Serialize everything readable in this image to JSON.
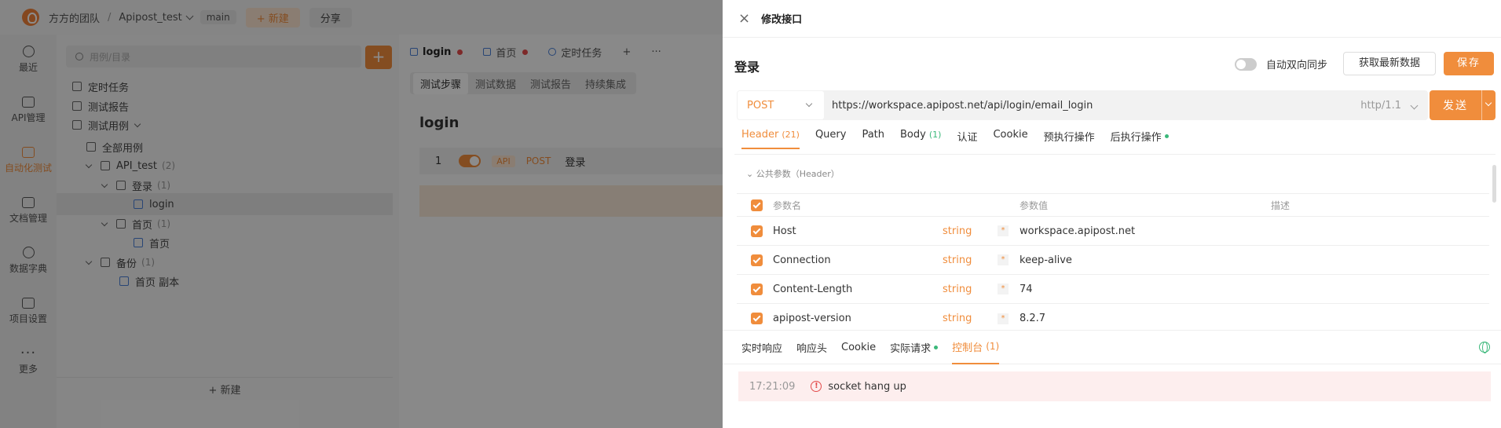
{
  "topbar": {
    "team": "方方的团队",
    "separator": "/",
    "project": "Apipost_test",
    "branch": "main",
    "new_label": "+ 新建",
    "share_label": "分享"
  },
  "leftnav": {
    "items": [
      {
        "label": "最近",
        "icon": "clock-icon"
      },
      {
        "label": "API管理",
        "icon": "api-icon"
      },
      {
        "label": "自动化测试",
        "icon": "automation-icon",
        "active": true
      },
      {
        "label": "文档管理",
        "icon": "document-icon"
      },
      {
        "label": "数据字典",
        "icon": "dictionary-icon"
      },
      {
        "label": "项目设置",
        "icon": "settings-icon"
      },
      {
        "label": "更多",
        "icon": "more-icon"
      }
    ]
  },
  "tree": {
    "search_placeholder": "用例/目录",
    "add_label": "+",
    "scheduled": "定时任务",
    "report": "测试报告",
    "cases": "测试用例",
    "all_cases": "全部用例",
    "api_test": "API_test",
    "api_test_count": "(2)",
    "login_folder": "登录",
    "login_count": "(1)",
    "login_item": "login",
    "home_folder": "首页",
    "home_count": "(1)",
    "home_item": "首页",
    "backup_folder": "备份",
    "backup_count": "(1)",
    "backup_item": "首页 副本",
    "new_label": "+ 新建"
  },
  "work": {
    "tabs": [
      {
        "label": "login"
      },
      {
        "label": "首页"
      },
      {
        "label": "定时任务"
      }
    ],
    "add_tab": "+",
    "more_tab": "···",
    "subtabs": [
      "测试步骤",
      "测试数据",
      "测试报告",
      "持续集成"
    ],
    "case_title": "login",
    "step_index": "1",
    "step_tag": "API",
    "step_method": "POST",
    "step_name": "登录"
  },
  "drawer": {
    "title": "修改接口",
    "api_name": "登录",
    "sync_label": "自动双向同步",
    "fetch_label": "获取最新数据",
    "save_label": "保存",
    "method": "POST",
    "url": "https://workspace.apipost.net/api/login/email_login",
    "protocol": "http/1.1",
    "send_label": "发送",
    "req_tabs": [
      {
        "label": "Header",
        "count": "(21)"
      },
      {
        "label": "Query",
        "count": ""
      },
      {
        "label": "Path",
        "count": ""
      },
      {
        "label": "Body",
        "count": "(1)"
      },
      {
        "label": "认证",
        "count": ""
      },
      {
        "label": "Cookie",
        "count": ""
      },
      {
        "label": "预执行操作",
        "count": ""
      },
      {
        "label": "后执行操作",
        "count": ""
      }
    ],
    "common_params": "公共参数（Header）",
    "grid_head": {
      "name": "参数名",
      "value": "参数值",
      "desc": "描述"
    },
    "rows": [
      {
        "name": "Host",
        "type": "string",
        "req": "*",
        "value": "workspace.apipost.net"
      },
      {
        "name": "Connection",
        "type": "string",
        "req": "*",
        "value": "keep-alive"
      },
      {
        "name": "Content-Length",
        "type": "string",
        "req": "*",
        "value": "74"
      },
      {
        "name": "apipost-version",
        "type": "string",
        "req": "*",
        "value": "8.2.7"
      }
    ],
    "resp_tabs": [
      {
        "label": "实时响应"
      },
      {
        "label": "响应头"
      },
      {
        "label": "Cookie"
      },
      {
        "label": "实际请求"
      },
      {
        "label": "控制台",
        "count": "(1)"
      }
    ],
    "log": {
      "time": "17:21:09",
      "message": "socket hang up"
    }
  }
}
